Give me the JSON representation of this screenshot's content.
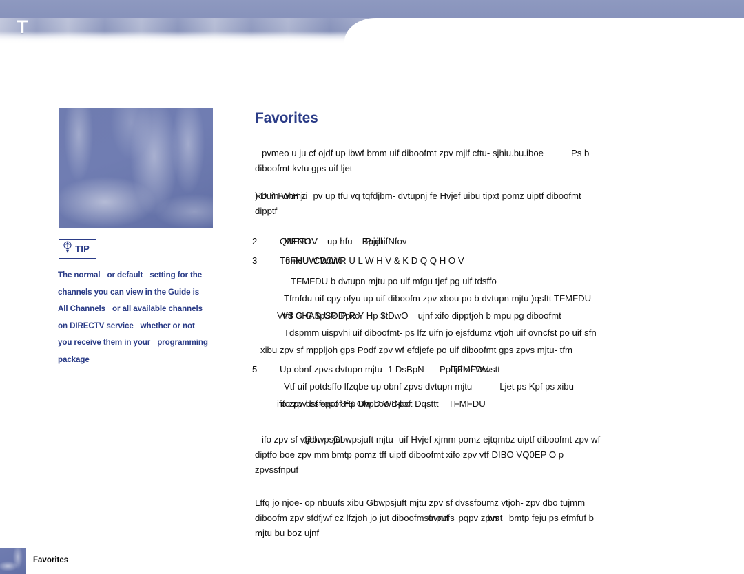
{
  "header": {
    "letter": "T",
    "banner_color": "#8792bb"
  },
  "sidebar": {
    "thumbnail_alt": "abstract-blue-swirl-image",
    "tip": {
      "icon": "lightbulb-icon",
      "label": "TIP",
      "lines": [
        {
          "a": "The normal",
          "b": "or default",
          "c": "setting for the"
        },
        {
          "a": "channels you can view in the Guide is",
          "b": "",
          "c": ""
        },
        {
          "a": "All Channels",
          "b": "or all available channels",
          "c": ""
        },
        {
          "a": "on DIRECTV service",
          "b": "whether or not",
          "c": ""
        },
        {
          "a": "you receive them in your",
          "b": "programming",
          "c": ""
        },
        {
          "a": "package",
          "b": "",
          "c": ""
        }
      ]
    }
  },
  "main": {
    "title": "Favorites",
    "intro": {
      "line1": "pvmeo  u  ju  cf  ojdf  up  ibwf  bmm  uif  diboofmt  zpv  mjlf  cftu-  sjhiu.bu.iboe",
      "line1_tail_gap": "Ps   b",
      "line2": "diboofmt  kvtu  gps  uif  ljet"
    },
    "note": {
      "prefix_overlay_front": ") D Y Fohmjti",
      "prefix_overlay_back": "Rbuin WtH z",
      "line1": "pv  up  tfu  vq  tqfdjbm-  dvtupnj  fe  Hvjef  uibu  tipxt  pomz  uiptf  diboofmt",
      "line2": "dipptf"
    },
    "steps": [
      {
        "num": "2",
        "overlay_front": "QNFFOV",
        "overlay_back": "MENU",
        "rest": "up   hfu",
        "overlay2_front": "Bpjdl",
        "overlay2_back": "RujuifNfov",
        "subs": []
      },
      {
        "num": "3",
        "overlay_front": "Tfmfdu",
        "overlay_back": "6FHUW Wuito",
        "rest_caps": "CDJWR U L W H V   & K D Q Q H O V",
        "subs": [
          {
            "indent": "ind1",
            "text": "TFMFDU   b   dvtupn   mjtu   po   uif   mfgu   tjef   pg   uif   tdsffo"
          },
          {
            "indent": "ind2",
            "text": "Tfmfdu   uif   cpy   ofyu   up   uif   diboofm   zpv   xbou   po   b   dvtupn   mjtu   )qsftt   TFMFDU"
          },
          {
            "indent": "ind3",
            "overlay_front": "Vtf$ G G   $pSOIP R Y Hp $tDwO",
            "overlay_back": "Vtf CHAN UP Dpxo",
            "tail": "ujnf   xifo   dipptjoh   b   mpu   pg   diboofmt"
          },
          {
            "indent": "ind2",
            "text": "Tdspmm   uispvhi   uif   diboofmt-   ps   lfz   uifn   jo   ejsfdumz   vtjoh   uif   ovncfst   po   uif   sfn"
          },
          {
            "indent": "ind5",
            "text": "xibu   zpv   sf   mppljoh   gps      Podf   zpv   wf   efdjefe   po   uif   diboofmt   gps   zpvs   mjtu-   tfm"
          }
        ]
      },
      {
        "num": "5",
        "overlay_front": "Up  obnf  zpvs  dvtupn  mjtu- 1 DsBpN",
        "overlay_back": "Ppl   pbof Wwstt",
        "rest_caps": "TFMFDU",
        "subs": [
          {
            "indent": "ind2",
            "text": "Vtf   uif   potdsffo   lfzqbe   up   obnf   zpvs   dvtupn   mjtu",
            "tail_gap": "Ljet      ps      Kpf      ps   xibu"
          },
          {
            "indent": "ind3",
            "overlay_front": "ifo  zpv  bsf  epof  8fS OhpD Wd-bot Dqsttt",
            "overlay_back": "ifo zpv bsf epof Hp Uw boe Dpof",
            "tail": "TFMFDU"
          }
        ]
      }
    ],
    "closing": {
      "line1_front": "ifo   zpv   sf   vtjoh",
      "line1_back": "@bwpsjut",
      "line1_rest": "Gbwpsjuft   mjtu-   uif   Hvjef   xjmm   pomz   ejtqmbz   uiptf   diboofmt   zpv   wf",
      "line2": "diptfo        boe   zpv   mm   bmtp   pomz   tff   uiptf   diboofmt   xifo   zpv   vtf   DIBO   VQ0EP   O   p",
      "line3": "zpvssfnpuf"
    },
    "final": {
      "line1": "Lffq   jo   njoe-   op   nbuufs   xibu   Gbwpsjuft   mjtu   zpv   sf   dvssfoumz   vtjoh-   zpv   dbo   tujmm",
      "line2_a": "diboofm   zpv   sfdfjwf   cz   lfzjoh   jo   jut   diboofm",
      "line2_overlay_front": "sfnpuf",
      "line2_overlay_back": "ovncfs",
      "line2_b": "pqpv   zpvs",
      "line2_overlay2_front": "bmt",
      "line2_c": "bmtp   feju   ps   efmfuf   b",
      "line3": "mjtu   bu   boz   ujnf"
    }
  },
  "footer": {
    "label": "Favorites",
    "thumbnail_alt": "abstract-blue-swirl-thumbnail"
  }
}
